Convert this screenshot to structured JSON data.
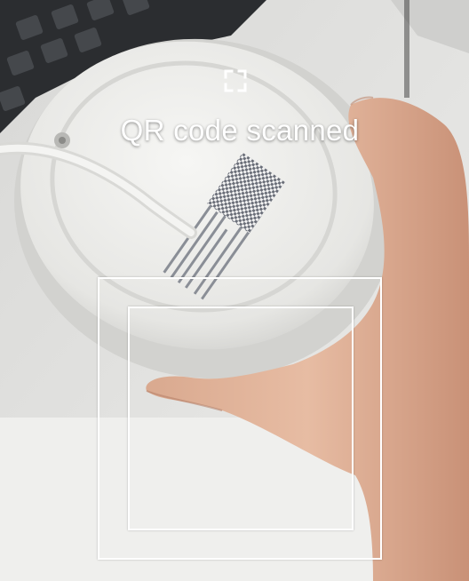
{
  "scanner": {
    "status_text": "QR code scanned",
    "scan_icon": "scan-frame-icon",
    "frame_color": "#ffffff"
  }
}
